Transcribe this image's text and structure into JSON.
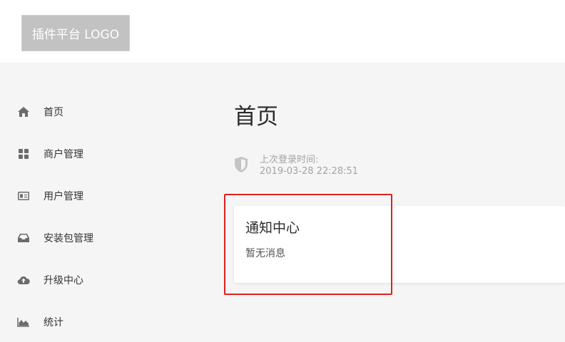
{
  "header": {
    "logo_text": "插件平台 LOGO"
  },
  "sidebar": {
    "items": [
      {
        "label": "首页",
        "icon": "home-icon"
      },
      {
        "label": "商户管理",
        "icon": "grid-icon"
      },
      {
        "label": "用户管理",
        "icon": "id-card-icon"
      },
      {
        "label": "安装包管理",
        "icon": "inbox-icon"
      },
      {
        "label": "升级中心",
        "icon": "cloud-upload-icon"
      },
      {
        "label": "统计",
        "icon": "area-chart-icon"
      }
    ]
  },
  "main": {
    "page_title": "首页",
    "last_login_label": "上次登录时间:",
    "last_login_time": "2019-03-28 22:28:51",
    "notice_card": {
      "title": "通知中心",
      "body": "暂无消息"
    }
  },
  "colors": {
    "logo_bg": "#c2c2c2",
    "page_bg": "#f5f5f5",
    "icon_color": "#6b6b6b",
    "muted_text": "#a3a3a3",
    "highlight_border": "#e02020"
  }
}
